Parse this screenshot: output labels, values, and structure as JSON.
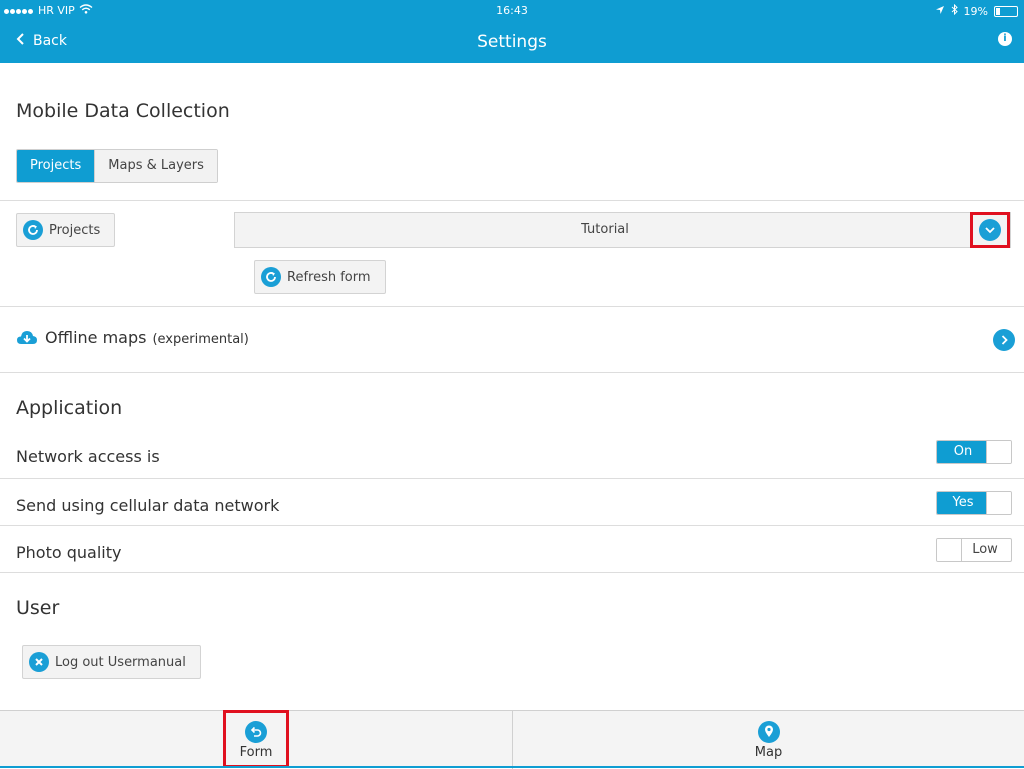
{
  "status_bar": {
    "carrier": "HR VIP",
    "time": "16:43",
    "battery": "19%",
    "battery_level": 0.19
  },
  "nav": {
    "back_label": "Back",
    "title": "Settings"
  },
  "section_mdc": {
    "title": "Mobile Data Collection",
    "tabs": [
      {
        "label": "Projects",
        "active": true
      },
      {
        "label": "Maps & Layers",
        "active": false
      }
    ]
  },
  "projects": {
    "button_label": "Projects",
    "selected_project": "Tutorial",
    "refresh_label": "Refresh form"
  },
  "offline_maps": {
    "label": "Offline maps",
    "note": "(experimental)"
  },
  "application": {
    "title": "Application",
    "rows": [
      {
        "label": "Network access is",
        "toggle": "On",
        "state": true
      },
      {
        "label": "Send using cellular data network",
        "toggle": "Yes",
        "state": true
      },
      {
        "label": "Photo quality",
        "toggle": "Low",
        "state": false
      }
    ]
  },
  "user": {
    "title": "User",
    "logout_label": "Log out Usermanual"
  },
  "tabbar": {
    "items": [
      {
        "label": "Form"
      },
      {
        "label": "Map"
      }
    ]
  },
  "colors": {
    "accent": "#0f9dd2",
    "highlight_outline": "#e0101f"
  }
}
